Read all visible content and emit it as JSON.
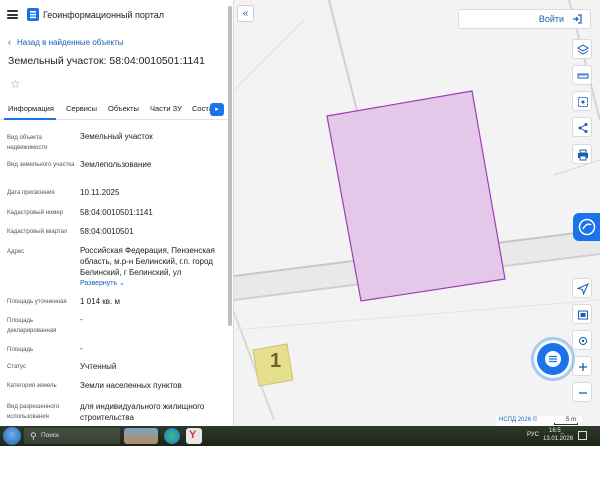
{
  "app": {
    "portal_title": "Геоинформационный портал"
  },
  "panel": {
    "back_link": "Назад в найденные объекты",
    "object_title": "Земельный участок: 58:04:0010501:1141",
    "tabs": [
      "Информация",
      "Сервисы",
      "Объекты",
      "Части ЗУ",
      "Соста"
    ],
    "active_tab": "Информация",
    "rows": [
      {
        "label": "Вид объекта недвижимости",
        "value": "Земельный участок"
      },
      {
        "label": "Вид земельного участка",
        "value": "Землепользование"
      },
      {
        "label": "Дата присвоения",
        "value": "10.11.2025"
      },
      {
        "label": "Кадастровый номер",
        "value": "58:04:0010501:1141"
      },
      {
        "label": "Кадастровый квартал",
        "value": "58:04:0010501"
      },
      {
        "label": "Адрес",
        "value": "Российская Федерация, Пензенская область, м.р-н Белинский, г.п. город Белинский, г Белинский, ул"
      },
      {
        "label": "Площадь уточненная",
        "value": "1 014 кв. м"
      },
      {
        "label": "Площадь декларированная",
        "value": "-"
      },
      {
        "label": "Площадь",
        "value": "-"
      },
      {
        "label": "Статус",
        "value": "Учтенный"
      },
      {
        "label": "Категория земель",
        "value": "Земли населенных пунктов"
      },
      {
        "label": "Вид разрешенного использования",
        "value": "для индивидуального жилищного строительства"
      }
    ],
    "expand_link": "Развернуть"
  },
  "header": {
    "login_label": "Войти"
  },
  "map": {
    "parcel_color": "#e3c8ea",
    "parcel_border": "#a23bb8",
    "building_number": "1",
    "scale_copyright": "НСПД 2026 ©",
    "scale_value": "5 m",
    "tools": [
      "layers-icon",
      "ruler-icon",
      "area-select-icon",
      "share-icon",
      "print-icon",
      "navigate-icon",
      "map-type-icon",
      "locate-icon",
      "zoom-in-icon",
      "zoom-out-icon"
    ]
  },
  "taskbar": {
    "search_placeholder": "Поиск",
    "lang": "РУС",
    "time": "16:5_",
    "date": "13.01.2026"
  },
  "colors": {
    "accent": "#1a73e8",
    "link": "#1a5fb4"
  }
}
